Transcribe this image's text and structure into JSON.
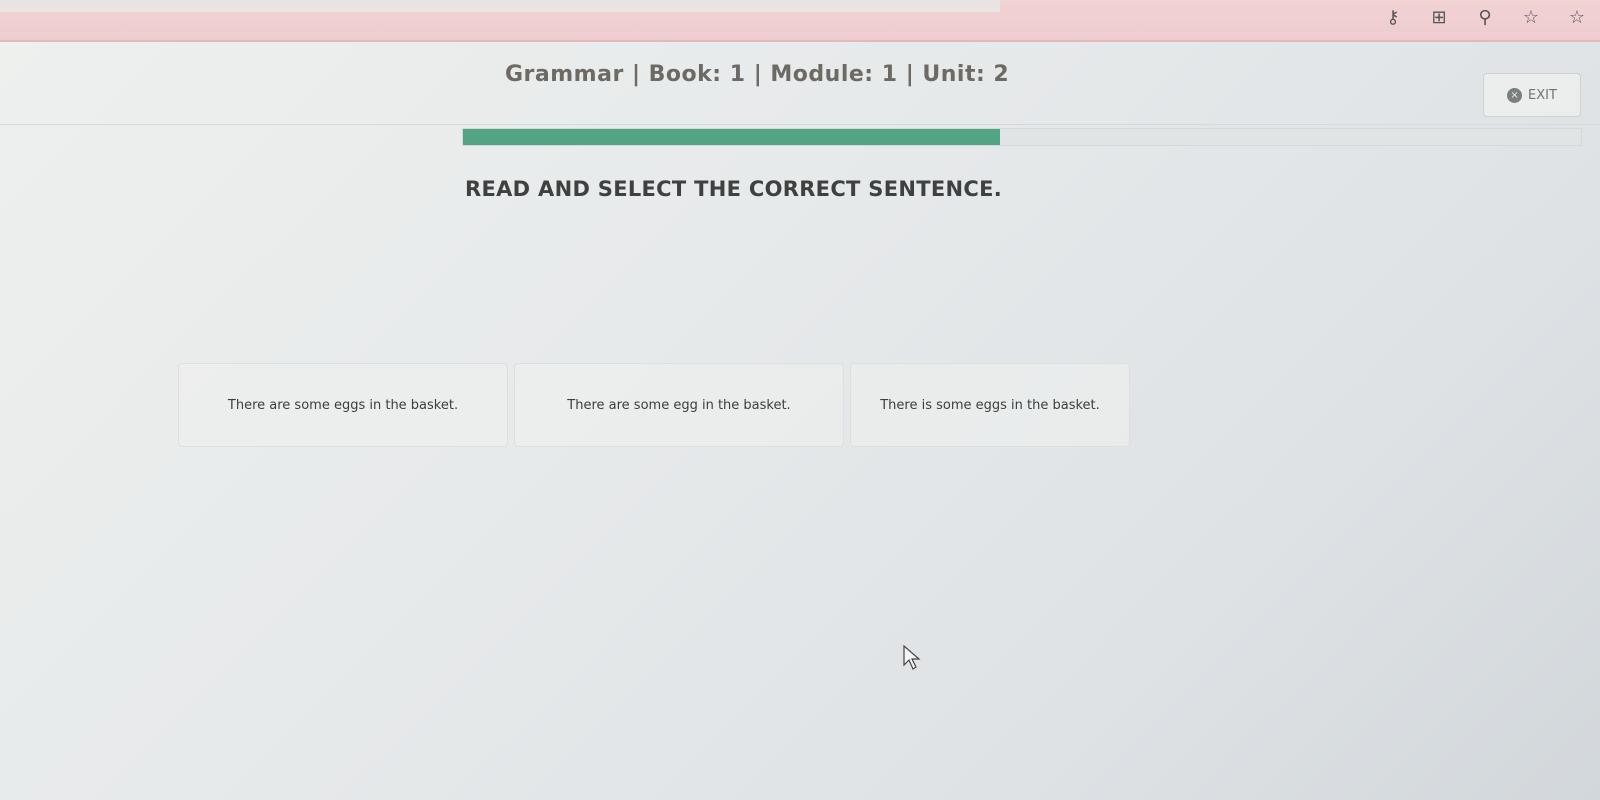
{
  "browser": {
    "icons": [
      {
        "name": "key-icon",
        "glyph": "⚷"
      },
      {
        "name": "apps-icon",
        "glyph": "⊞"
      },
      {
        "name": "zoom-icon",
        "glyph": "⚲"
      },
      {
        "name": "star-icon",
        "glyph": "☆"
      },
      {
        "name": "favorites-icon",
        "glyph": "☆"
      }
    ]
  },
  "header": {
    "title": "Grammar | Book: 1 | Module: 1 | Unit: 2",
    "exit_label": "EXIT",
    "exit_icon": "×"
  },
  "progress": {
    "fraction": 0.48,
    "color": "#53a484"
  },
  "question": {
    "instruction": "READ AND SELECT THE CORRECT SENTENCE.",
    "options": [
      "There are some eggs in the basket.",
      "There are some egg in the basket.",
      "There is some eggs in the basket."
    ]
  }
}
